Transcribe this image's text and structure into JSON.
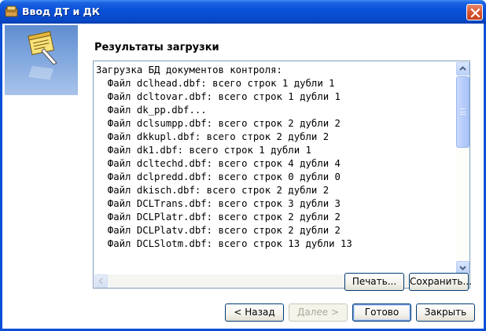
{
  "window": {
    "title": "Ввод ДТ и ДК"
  },
  "main": {
    "heading": "Результаты загрузки",
    "results_lines": [
      "Загрузка БД документов контроля:",
      "  Файл dclhead.dbf: всего строк 1 дубли 1",
      "  Файл dcltovar.dbf: всего строк 1 дубли 1",
      "  Файл dk_pp.dbf...",
      "  Файл dclsumpp.dbf: всего строк 2 дубли 2",
      "  Файл dkkupl.dbf: всего строк 2 дубли 2",
      "  Файл dk1.dbf: всего строк 1 дубли 1",
      "  Файл dcltechd.dbf: всего строк 4 дубли 4",
      "  Файл dclpredd.dbf: всего строк 0 дубли 0",
      "  Файл dkisch.dbf: всего строк 2 дубли 2",
      "  Файл DCLTrans.dbf: всего строк 3 дубли 3",
      "  Файл DCLPlatr.dbf: всего строк 2 дубли 2",
      "  Файл DCLPlatv.dbf: всего строк 2 дубли 2",
      "  Файл DCLSlotm.dbf: всего строк 13 дубли 13"
    ]
  },
  "buttons": {
    "print": "Печать...",
    "save": "Сохранить...",
    "back": "< Назад",
    "next": "Далее >",
    "finish": "Готово",
    "close": "Закрыть"
  },
  "icons": {
    "title": "wizard-app-icon",
    "close": "close-icon",
    "side": "wizard-document-icon"
  }
}
